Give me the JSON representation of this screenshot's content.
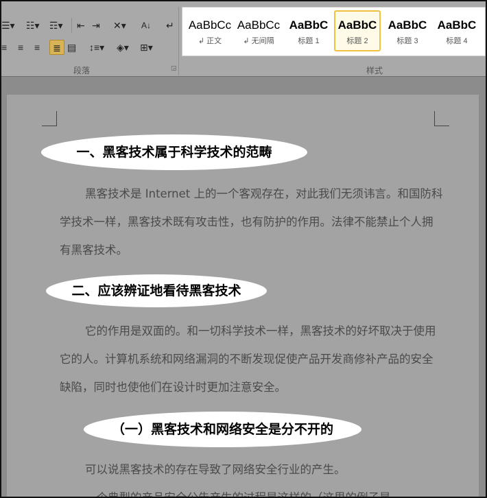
{
  "ribbon": {
    "paragraph_group_label": "段落",
    "styles_group_label": "样式",
    "styles": [
      {
        "preview": "AaBbCc",
        "name": "↲ 正文"
      },
      {
        "preview": "AaBbCc",
        "name": "↲ 无间隔"
      },
      {
        "preview": "AaBbC",
        "name": "标题 1"
      },
      {
        "preview": "AaBbC",
        "name": "标题 2",
        "selected": true
      },
      {
        "preview": "AaBbC",
        "name": "标题 3"
      },
      {
        "preview": "AaBbC",
        "name": "标题 4"
      }
    ]
  },
  "document": {
    "h1": "一、黑客技术属于科学技术的范畴",
    "p1": "黑客技术是 Internet 上的一个客观存在，对此我们无须讳言。和国防科学技术一样，黑客技术既有攻击性，也有防护的作用。法律不能禁止个人拥有黑客技术。",
    "h2": "二、应该辨证地看待黑客技术",
    "p2": "它的作用是双面的。和一切科学技术一样，黑客技术的好坏取决于使用它的人。计算机系统和网络漏洞的不断发现促使产品开发商修补产品的安全缺陷，同时也使他们在设计时更加注意安全。",
    "h3": "（一）黑客技术和网络安全是分不开的",
    "p3": "可以说黑客技术的存在导致了网络安全行业的产生。",
    "p4": "一个典型的产品安全公告产生的过程是这样的（这里的例子是"
  }
}
